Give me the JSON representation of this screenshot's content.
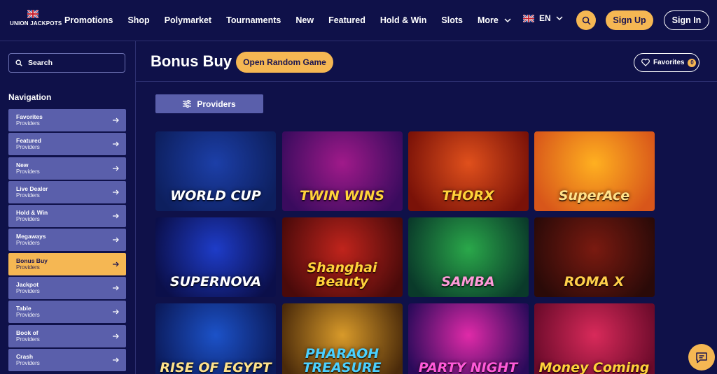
{
  "header": {
    "logo_text": "UNION JACKPOTS",
    "nav": [
      "Promotions",
      "Shop",
      "Polymarket",
      "Tournaments",
      "New",
      "Featured",
      "Hold & Win",
      "Slots"
    ],
    "more_label": "More",
    "lang_label": "EN",
    "signup_label": "Sign Up",
    "signin_label": "Sign In"
  },
  "sidebar": {
    "search_placeholder": "Search",
    "nav_title": "Navigation",
    "items": [
      {
        "label": "Favorites",
        "sub": "Providers"
      },
      {
        "label": "Featured",
        "sub": "Providers"
      },
      {
        "label": "New",
        "sub": "Providers"
      },
      {
        "label": "Live Dealer",
        "sub": "Providers"
      },
      {
        "label": "Hold & Win",
        "sub": "Providers"
      },
      {
        "label": "Megaways",
        "sub": "Providers"
      },
      {
        "label": "Bonus Buy",
        "sub": "Providers"
      },
      {
        "label": "Jackpot",
        "sub": "Providers"
      },
      {
        "label": "Table",
        "sub": "Providers"
      },
      {
        "label": "Book of",
        "sub": "Providers"
      },
      {
        "label": "Crash",
        "sub": "Providers"
      }
    ],
    "active_item": "Bonus Buy"
  },
  "main": {
    "title": "Bonus Buy",
    "random_label": "Open Random Game",
    "favorites_label": "Favorites",
    "favorites_count": "0",
    "providers_label": "Providers",
    "games": [
      {
        "name": "WORLD CUP",
        "c1": "#1c3fa8",
        "c2": "#0d1f5e",
        "text": "#ffffff"
      },
      {
        "name": "TWIN WINS",
        "c1": "#a01a8a",
        "c2": "#3a0b5e",
        "text": "#ffd23a"
      },
      {
        "name": "THORX",
        "c1": "#e0501c",
        "c2": "#7a1208",
        "text": "#ffd23a"
      },
      {
        "name": "SuperAce",
        "c1": "#ffb020",
        "c2": "#d8561a",
        "text": "#ffe28a"
      },
      {
        "name": "SUPERNOVA",
        "c1": "#1e3cc8",
        "c2": "#0b0f4a",
        "text": "#ffffff"
      },
      {
        "name": "Shanghai Beauty",
        "c1": "#c0241c",
        "c2": "#4a0a0a",
        "text": "#ffd23a"
      },
      {
        "name": "SAMBA",
        "c1": "#2aa84a",
        "c2": "#0a3a2a",
        "text": "#ff9ad8"
      },
      {
        "name": "ROMA X",
        "c1": "#7a1a10",
        "c2": "#2a0a08",
        "text": "#ffcf4a"
      },
      {
        "name": "RISE OF EGYPT",
        "c1": "#1c52c8",
        "c2": "#0b1a5a",
        "text": "#ffe28a"
      },
      {
        "name": "PHARAOH TREASURE",
        "c1": "#d89a2a",
        "c2": "#4a2a0a",
        "text": "#4ad0ff"
      },
      {
        "name": "PARTY NIGHT",
        "c1": "#e02aa8",
        "c2": "#2a0a5a",
        "text": "#ff5ad8"
      },
      {
        "name": "Money Coming",
        "c1": "#d82a5a",
        "c2": "#6a0a2a",
        "text": "#ffd23a"
      }
    ]
  },
  "colors": {
    "background": "#0f1149",
    "accent": "#f5b753",
    "sidebar_item": "#5a5fab"
  }
}
